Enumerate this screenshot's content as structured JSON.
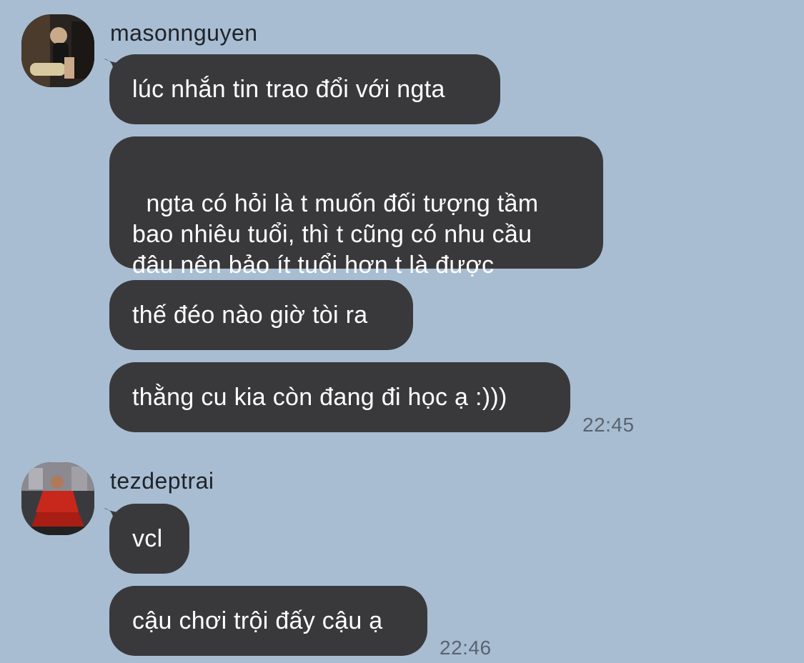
{
  "colors": {
    "background": "#a8bdd2",
    "bubble": "#39393c",
    "bubble_text": "#ffffff",
    "name_text": "#1f2329",
    "time_text": "#5a6470"
  },
  "groups": [
    {
      "sender": "masonnguyen",
      "avatar_icon": "user-avatar-photo",
      "messages": [
        "lúc nhắn tin trao đổi với ngta",
        "ngta có hỏi là t muốn đối tượng tầm\nbao nhiêu tuổi, thì t cũng có nhu cầu\nđâu nên bảo ít tuổi hơn t là được",
        "thế đéo nào giờ tòi ra",
        "thằng cu kia còn đang đi học ạ :)))"
      ],
      "time": "22:45"
    },
    {
      "sender": "tezdeptrai",
      "avatar_icon": "user-avatar-photo",
      "messages": [
        "vcl",
        "cậu chơi trội đấy cậu ạ"
      ],
      "time": "22:46"
    }
  ]
}
